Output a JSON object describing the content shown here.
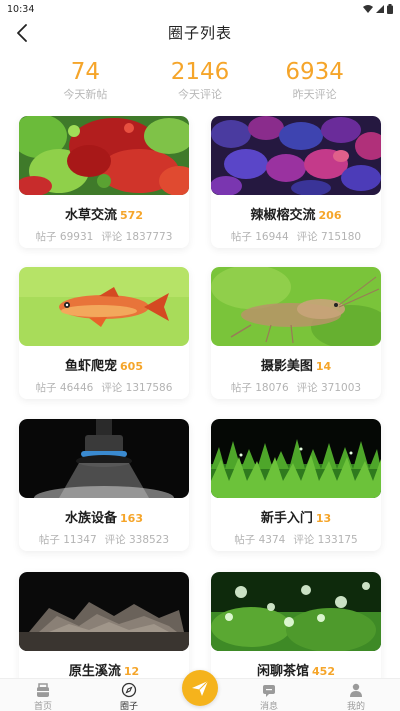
{
  "status_bar": {
    "time": "10:34"
  },
  "header": {
    "title": "圈子列表"
  },
  "stats": [
    {
      "value": "74",
      "label": "今天新帖"
    },
    {
      "value": "2146",
      "label": "今天评论"
    },
    {
      "value": "6934",
      "label": "昨天评论"
    }
  ],
  "circles": [
    {
      "title": "水草交流",
      "count": "572",
      "posts": "帖子 69931",
      "comments": "评论 1837773",
      "image": "aquatic-plants"
    },
    {
      "title": "辣椒榕交流",
      "count": "206",
      "posts": "帖子 16944",
      "comments": "评论 715180",
      "image": "bucephalandra"
    },
    {
      "title": "鱼虾爬宠",
      "count": "605",
      "posts": "帖子 46446",
      "comments": "评论 1317586",
      "image": "red-fish"
    },
    {
      "title": "摄影美图",
      "count": "14",
      "posts": "帖子 18076",
      "comments": "评论 371003",
      "image": "shrimp"
    },
    {
      "title": "水族设备",
      "count": "163",
      "posts": "帖子 11347",
      "comments": "评论 338523",
      "image": "aquarium-light"
    },
    {
      "title": "新手入门",
      "count": "13",
      "posts": "帖子 4374",
      "comments": "评论 133175",
      "image": "grass-carpet"
    },
    {
      "title": "原生溪流",
      "count": "12",
      "posts": "",
      "comments": "",
      "image": "stream-rocks"
    },
    {
      "title": "闲聊茶馆",
      "count": "452",
      "posts": "",
      "comments": "",
      "image": "bubbles-plants"
    }
  ],
  "tabbar": {
    "home": "首页",
    "circles": "圈子",
    "messages": "消息",
    "mine": "我的"
  },
  "colors": {
    "accent": "#f5a52a",
    "fab": "#f5b31c"
  }
}
